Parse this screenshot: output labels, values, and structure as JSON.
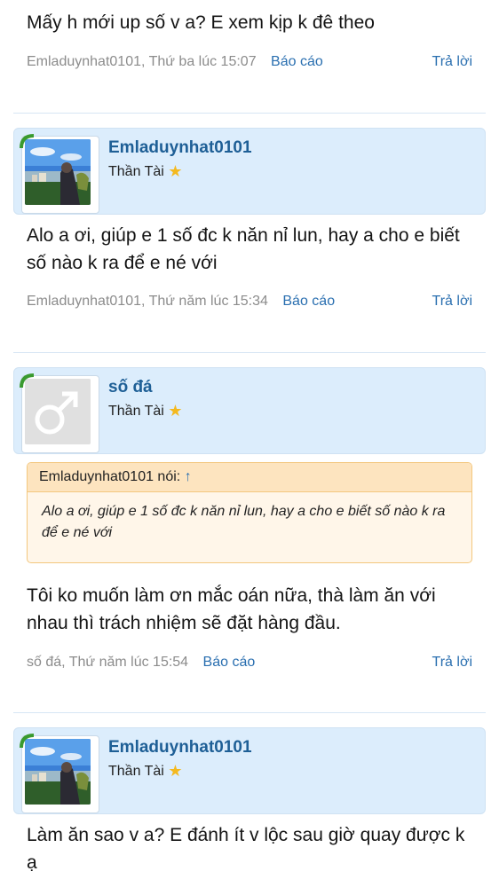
{
  "posts": [
    {
      "text": "Mấy h mới up số v a? E xem kịp k đê theo",
      "author_time": "Emladuynhat0101, Thứ ba lúc 15:07",
      "report": "Báo cáo",
      "reply": "Trả lời"
    },
    {
      "username": "Emladuynhat0101",
      "title": "Thần Tài",
      "avatar": "landscape-photo",
      "text": "Alo a ơi, giúp e 1 số đc k năn nỉ lun, hay a cho e biết số nào k ra để e né với",
      "author_time": "Emladuynhat0101, Thứ năm lúc 15:34",
      "report": "Báo cáo",
      "reply": "Trả lời"
    },
    {
      "username": "số đá",
      "title": "Thần Tài",
      "avatar": "male-symbol-icon",
      "quote": {
        "header": "Emladuynhat0101 nói:",
        "arrow": "↑",
        "text": "Alo a ơi, giúp e 1 số đc k năn nỉ lun, hay a cho e biết số nào k ra để e né với"
      },
      "text": "Tôi ko muốn làm ơn mắc oán nữa, thà làm ăn với nhau thì trách nhiệm sẽ đặt hàng đầu.",
      "author_time": "số đá, Thứ năm lúc 15:54",
      "report": "Báo cáo",
      "reply": "Trả lời"
    },
    {
      "username": "Emladuynhat0101",
      "title": "Thần Tài",
      "avatar": "landscape-photo",
      "text": "Làm ăn sao v a? E đánh ít v lộc sau giờ quay được k ạ"
    }
  ],
  "colors": {
    "link": "#2a6fb0",
    "username": "#1e5f96",
    "userbar_bg": "#dcedfc",
    "quote_bg": "#fff6e9",
    "quote_border": "#f3c77e",
    "star": "#f4b91f"
  }
}
